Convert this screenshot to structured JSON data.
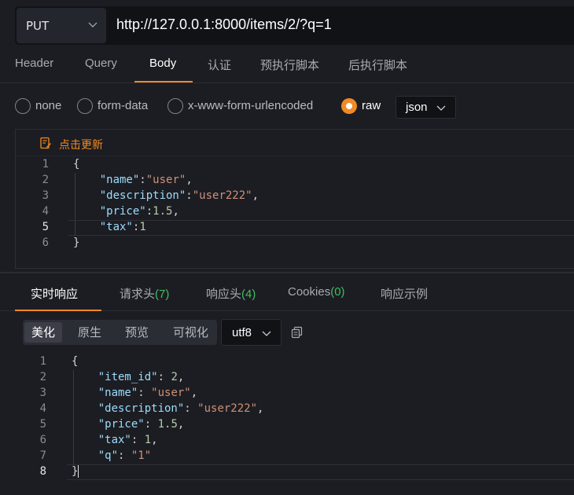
{
  "request": {
    "method": "PUT",
    "url": "http://127.0.0.1:8000/items/2/?q=1"
  },
  "top_tabs": [
    "Header",
    "Query",
    "Body",
    "认证",
    "预执行脚本",
    "后执行脚本"
  ],
  "active_top_tab": "Body",
  "body_types": [
    "none",
    "form-data",
    "x-www-form-urlencoded",
    "raw"
  ],
  "selected_body_type": "raw",
  "raw_format": "json",
  "editor": {
    "update_label": "点击更新",
    "line_numbers": [
      "1",
      "2",
      "3",
      "4",
      "5",
      "6"
    ],
    "current_line": "5",
    "lines": [
      [
        {
          "t": "{",
          "c": "punc"
        }
      ],
      [
        {
          "t": "    ",
          "c": "punc"
        },
        {
          "t": "\"name\"",
          "c": "key"
        },
        {
          "t": ":",
          "c": "punc"
        },
        {
          "t": "\"user\"",
          "c": "str"
        },
        {
          "t": ",",
          "c": "punc"
        }
      ],
      [
        {
          "t": "    ",
          "c": "punc"
        },
        {
          "t": "\"description\"",
          "c": "key"
        },
        {
          "t": ":",
          "c": "punc"
        },
        {
          "t": "\"user222\"",
          "c": "str"
        },
        {
          "t": ",",
          "c": "punc"
        }
      ],
      [
        {
          "t": "    ",
          "c": "punc"
        },
        {
          "t": "\"price\"",
          "c": "key"
        },
        {
          "t": ":",
          "c": "punc"
        },
        {
          "t": "1.5",
          "c": "num"
        },
        {
          "t": ",",
          "c": "punc"
        }
      ],
      [
        {
          "t": "    ",
          "c": "punc"
        },
        {
          "t": "\"tax\"",
          "c": "key"
        },
        {
          "t": ":",
          "c": "punc"
        },
        {
          "t": "1",
          "c": "num"
        }
      ],
      [
        {
          "t": "}",
          "c": "punc"
        }
      ]
    ]
  },
  "response_tabs": [
    {
      "label": "实时响应",
      "count": ""
    },
    {
      "label": "请求头",
      "count": "(7)"
    },
    {
      "label": "响应头",
      "count": "(4)"
    },
    {
      "label": "Cookies",
      "count": "(0)"
    },
    {
      "label": "响应示例",
      "count": ""
    }
  ],
  "active_response_tab": "实时响应",
  "view_modes": [
    "美化",
    "原生",
    "预览",
    "可视化"
  ],
  "active_view_mode": "美化",
  "encoding": "utf8",
  "response": {
    "line_numbers": [
      "1",
      "2",
      "3",
      "4",
      "5",
      "6",
      "7",
      "8"
    ],
    "current_line": "8",
    "lines": [
      [
        {
          "t": "{",
          "c": "punc"
        }
      ],
      [
        {
          "t": "    ",
          "c": "punc"
        },
        {
          "t": "\"item_id\"",
          "c": "key"
        },
        {
          "t": ": ",
          "c": "punc"
        },
        {
          "t": "2",
          "c": "num"
        },
        {
          "t": ",",
          "c": "punc"
        }
      ],
      [
        {
          "t": "    ",
          "c": "punc"
        },
        {
          "t": "\"name\"",
          "c": "key"
        },
        {
          "t": ": ",
          "c": "punc"
        },
        {
          "t": "\"user\"",
          "c": "str"
        },
        {
          "t": ",",
          "c": "punc"
        }
      ],
      [
        {
          "t": "    ",
          "c": "punc"
        },
        {
          "t": "\"description\"",
          "c": "key"
        },
        {
          "t": ": ",
          "c": "punc"
        },
        {
          "t": "\"user222\"",
          "c": "str"
        },
        {
          "t": ",",
          "c": "punc"
        }
      ],
      [
        {
          "t": "    ",
          "c": "punc"
        },
        {
          "t": "\"price\"",
          "c": "key"
        },
        {
          "t": ": ",
          "c": "punc"
        },
        {
          "t": "1.5",
          "c": "num"
        },
        {
          "t": ",",
          "c": "punc"
        }
      ],
      [
        {
          "t": "    ",
          "c": "punc"
        },
        {
          "t": "\"tax\"",
          "c": "key"
        },
        {
          "t": ": ",
          "c": "punc"
        },
        {
          "t": "1",
          "c": "num"
        },
        {
          "t": ",",
          "c": "punc"
        }
      ],
      [
        {
          "t": "    ",
          "c": "punc"
        },
        {
          "t": "\"q\"",
          "c": "key"
        },
        {
          "t": ": ",
          "c": "punc"
        },
        {
          "t": "\"1\"",
          "c": "str"
        }
      ],
      [
        {
          "t": "}",
          "c": "punc"
        }
      ]
    ]
  },
  "colors": {
    "accent": "#f08a24",
    "count_green": "#3fbf5f",
    "background": "#1c1d22"
  }
}
